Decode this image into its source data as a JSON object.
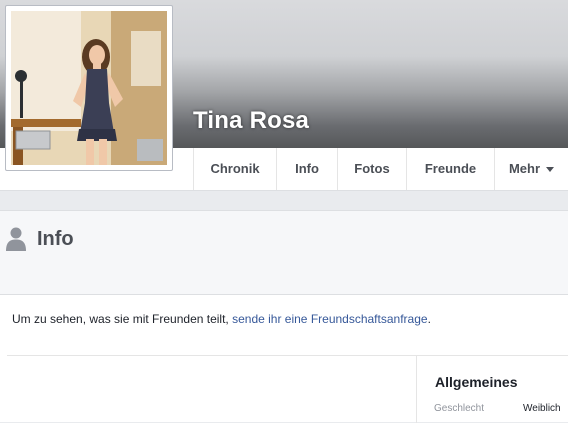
{
  "profile": {
    "name": "Tina Rosa",
    "photo_icon": "profile-photo-person"
  },
  "tabs": [
    {
      "label": "Chronik"
    },
    {
      "label": "Info"
    },
    {
      "label": "Fotos"
    },
    {
      "label": "Freunde"
    },
    {
      "label": "Mehr"
    }
  ],
  "info": {
    "title": "Info",
    "icon": "person-icon",
    "notice_prefix": "Um zu sehen, was sie mit Freunden teilt, ",
    "notice_link": "sende ihr eine Freundschaftsanfrage",
    "notice_suffix": "."
  },
  "sidebar": {
    "title": "Allgemeines",
    "rows": [
      {
        "key": "Geschlecht",
        "value": "Weiblich"
      }
    ]
  },
  "colors": {
    "link": "#365899",
    "tab_text": "#4b4f56",
    "page_bg": "#e9ebee"
  }
}
